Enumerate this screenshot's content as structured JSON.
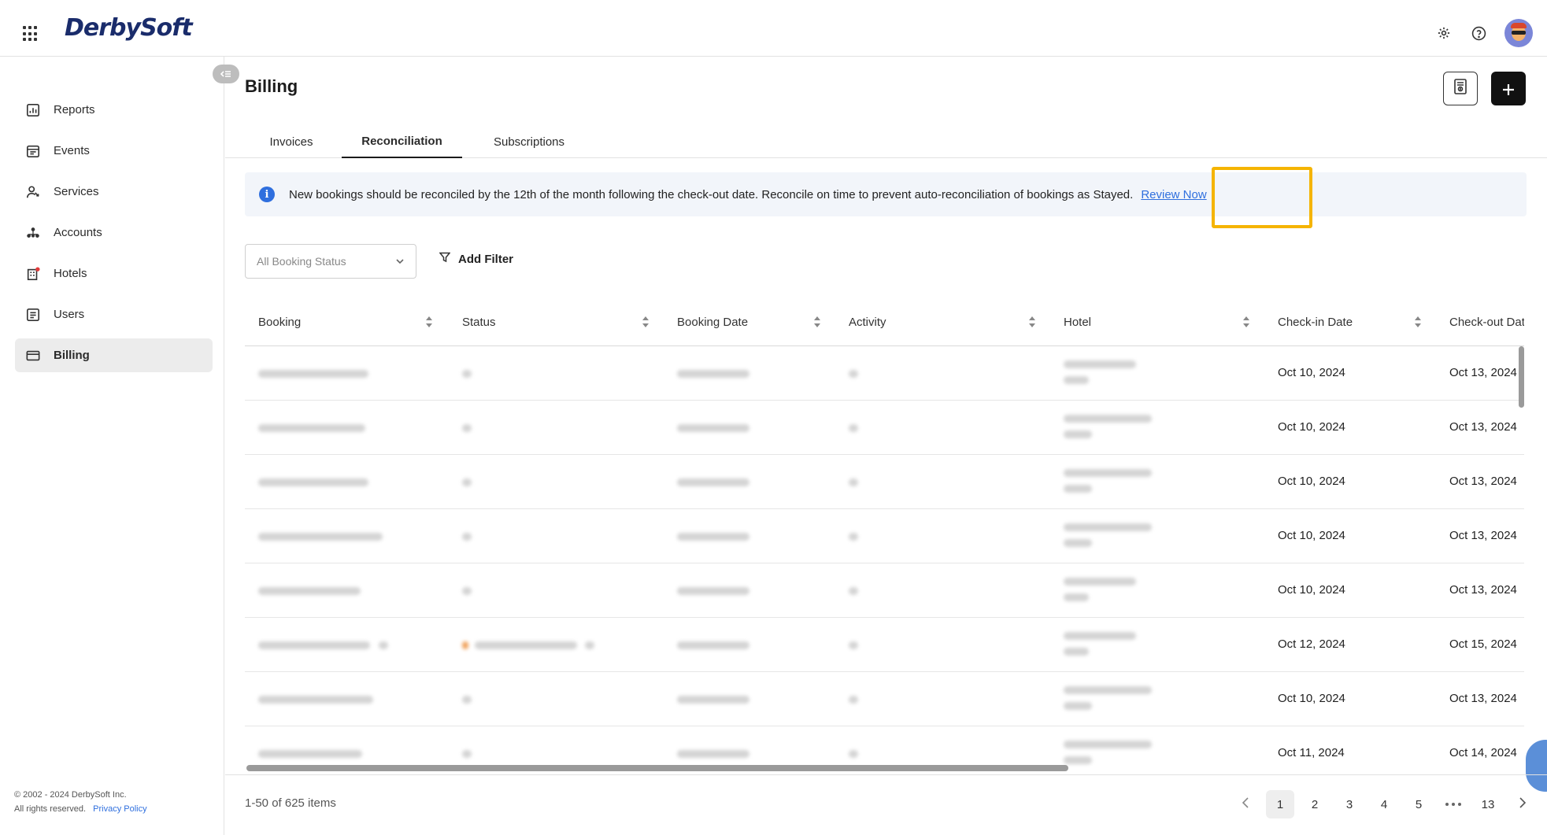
{
  "app": {
    "logo": "DerbySoft"
  },
  "sidebar": {
    "items": [
      {
        "label": "Reports",
        "icon": "reports-icon"
      },
      {
        "label": "Events",
        "icon": "events-icon"
      },
      {
        "label": "Services",
        "icon": "services-icon"
      },
      {
        "label": "Accounts",
        "icon": "accounts-icon"
      },
      {
        "label": "Hotels",
        "icon": "hotels-icon"
      },
      {
        "label": "Users",
        "icon": "users-icon"
      },
      {
        "label": "Billing",
        "icon": "billing-icon",
        "active": true
      }
    ],
    "footer": {
      "copyright": "© 2002 - 2024 DerbySoft Inc.",
      "rights": "All rights reserved.",
      "privacy": "Privacy Policy"
    }
  },
  "page": {
    "title": "Billing"
  },
  "tabs": [
    {
      "label": "Invoices"
    },
    {
      "label": "Reconciliation",
      "active": true
    },
    {
      "label": "Subscriptions"
    }
  ],
  "notice": {
    "text": "New bookings should be reconciled by the 12th of the month following the check-out date. Reconcile on time to prevent auto-reconciliation of bookings as Stayed.",
    "link": "Review Now"
  },
  "filters": {
    "status_placeholder": "All Booking Status",
    "add_filter": "Add Filter"
  },
  "table": {
    "columns": [
      "Booking",
      "Status",
      "Booking Date",
      "Activity",
      "Hotel",
      "Check-in Date",
      "Check-out Date"
    ],
    "rows": [
      {
        "checkin": "Oct 10, 2024",
        "checkout": "Oct 13, 2024"
      },
      {
        "checkin": "Oct 10, 2024",
        "checkout": "Oct 13, 2024"
      },
      {
        "checkin": "Oct 10, 2024",
        "checkout": "Oct 13, 2024"
      },
      {
        "checkin": "Oct 10, 2024",
        "checkout": "Oct 13, 2024"
      },
      {
        "checkin": "Oct 10, 2024",
        "checkout": "Oct 13, 2024"
      },
      {
        "checkin": "Oct 12, 2024",
        "checkout": "Oct 15, 2024"
      },
      {
        "checkin": "Oct 10, 2024",
        "checkout": "Oct 13, 2024"
      },
      {
        "checkin": "Oct 11, 2024",
        "checkout": "Oct 14, 2024"
      }
    ]
  },
  "pagination": {
    "summary": "1-50 of 625 items",
    "pages": [
      "1",
      "2",
      "3",
      "4",
      "5"
    ],
    "last_page": "13",
    "current": "1"
  },
  "colors": {
    "accent": "#2f6fde",
    "highlight": "#f5b400",
    "brand": "#1a2c6b"
  }
}
